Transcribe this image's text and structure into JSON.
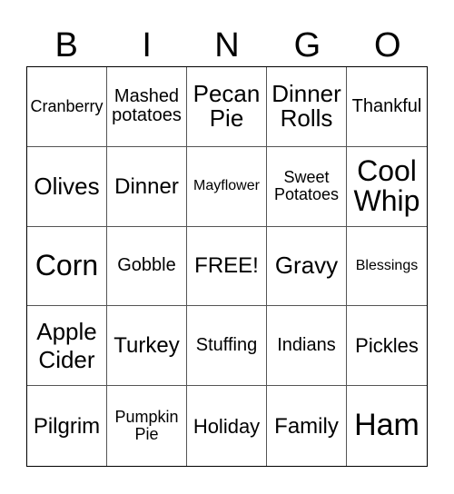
{
  "header": [
    "B",
    "I",
    "N",
    "G",
    "O"
  ],
  "cells": [
    "Cranberry",
    "Mashed\npotatoes",
    "Pecan\nPie",
    "Dinner\nRolls",
    "Thankful",
    "Olives",
    "Dinner",
    "Mayflower",
    "Sweet\nPotatoes",
    "Cool\nWhip",
    "Corn",
    "Gobble",
    "FREE!",
    "Gravy",
    "Blessings",
    "Apple\nCider",
    "Turkey",
    "Stuffing",
    "Indians",
    "Pickles",
    "Pilgrim",
    "Pumpkin\nPie",
    "Holiday",
    "Family",
    "Ham"
  ]
}
